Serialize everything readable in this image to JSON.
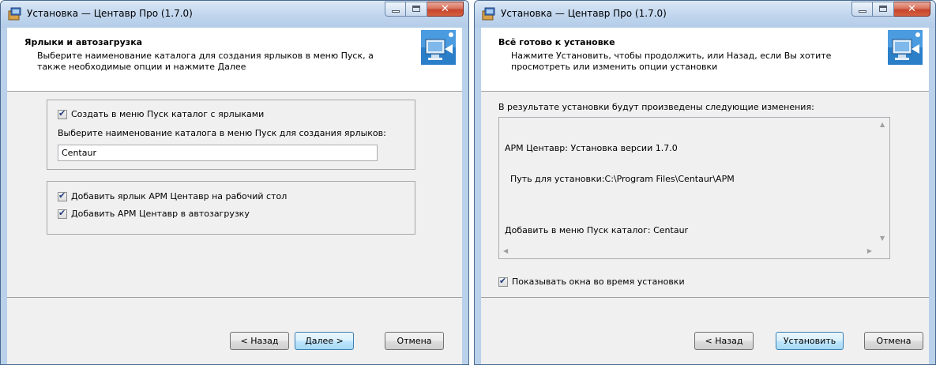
{
  "left_window": {
    "title": "Установка — Центавр Про (1.7.0)",
    "header_title": "Ярлыки и автозагрузка",
    "header_subtitle": "Выберите наименование каталога для создания ярлыков в меню Пуск, а также необходимые опции и нажмите Далее",
    "create_start_menu_checkbox": "Создать в меню Пуск каталог с ярлыками",
    "folder_prompt": "Выберите наименование каталога в меню Пуск для создания ярлыков:",
    "folder_value": "Centaur",
    "desktop_shortcut_checkbox": "Добавить ярлык АРМ Центавр на рабочий стол",
    "autostart_checkbox": "Добавить АРМ Центавр в автозагрузку",
    "back_button": "< Назад",
    "next_button": "Далее >",
    "cancel_button": "Отмена"
  },
  "right_window": {
    "title": "Установка — Центавр Про (1.7.0)",
    "header_title": "Всё готово к установке",
    "header_subtitle": "Нажмите Установить, чтобы продолжить, или Назад, если Вы хотите просмотреть или изменить опции установки",
    "summary_label": "В результате установки будут произведены следующие изменения:",
    "summary_lines": [
      "АРМ Центавр: Установка версии 1.7.0",
      "  Путь для установки:C:\\Program Files\\Centaur\\APM",
      "",
      "Добавить в меню Пуск каталог: Centaur"
    ],
    "show_windows_checkbox": "Показывать окна во время установки",
    "back_button": "< Назад",
    "install_button": "Установить",
    "cancel_button": "Отмена"
  },
  "icons": {
    "app": "installer-box-icon",
    "wizard": "computer-setup-icon",
    "minimize": "minimize-icon",
    "maximize": "maximize-icon",
    "close": "close-icon"
  },
  "colors": {
    "close_button": "#c7452d",
    "title_bar": "#c4d8ef",
    "default_button": "#a7d9f5"
  }
}
